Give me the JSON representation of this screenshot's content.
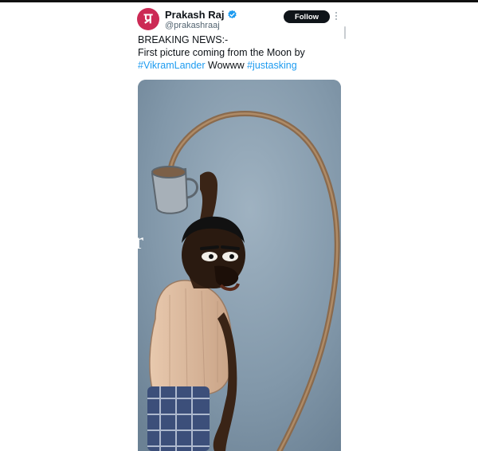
{
  "tweet": {
    "author_name": "Prakash Raj",
    "author_handle": "@prakashraaj",
    "avatar_glyph": "प्र",
    "follow_label": "Follow",
    "text_line1": "BREAKING NEWS:-",
    "text_line2": "First picture coming from the Moon by",
    "hashtag1": "#VikramLander",
    "text_mid": " Wowww ",
    "hashtag2": "#justasking",
    "media_edge_text": "r"
  },
  "colors": {
    "avatar_bg": "#cc2a55",
    "follow_bg": "#0f1419",
    "hashtag": "#1d9bf0",
    "verified": "#1d9bf0",
    "media_bg": "#7f94a5"
  },
  "icons": {
    "verified": "verified-badge-icon",
    "more": "more-options-icon"
  }
}
